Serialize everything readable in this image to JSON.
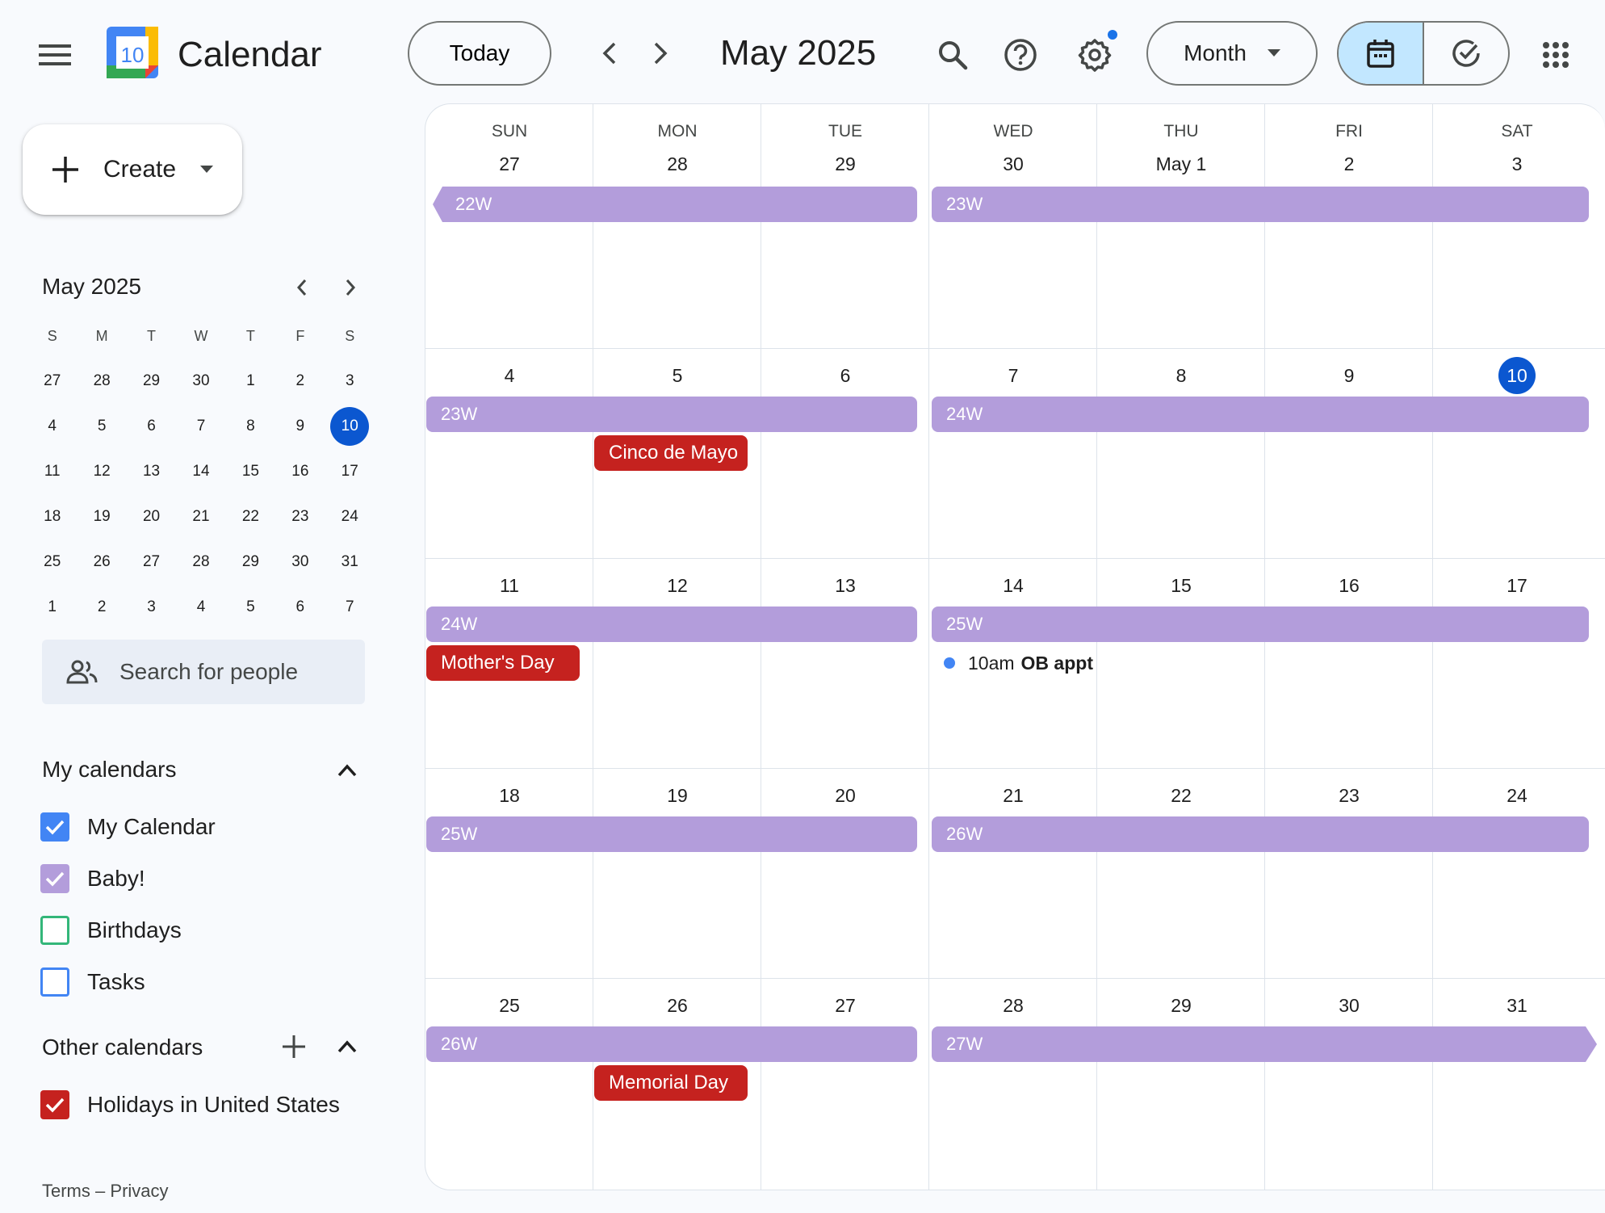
{
  "header": {
    "app_title": "Calendar",
    "logo_day": "10",
    "today_label": "Today",
    "period_title": "May 2025",
    "view_label": "Month"
  },
  "icons": {
    "menu": "hamburger-menu-icon",
    "prev": "chevron-left-icon",
    "next": "chevron-right-icon",
    "search": "search-icon",
    "help": "help-icon",
    "settings": "gear-icon",
    "dropdown": "caret-down-icon",
    "calendar_mode": "calendar-icon",
    "tasks_mode": "task-check-icon",
    "apps": "apps-grid-icon",
    "create": "plus-icon",
    "people": "people-icon"
  },
  "colors": {
    "accent": "#0b57d0",
    "notification_dot": "#1a73e8",
    "week_bar": "#b39ddb",
    "holiday_event": "#c5221f",
    "timed_event_dot": "#4285f4",
    "mode_selected_bg": "#c2e7ff"
  },
  "create": {
    "label": "Create"
  },
  "mini_calendar": {
    "title": "May 2025",
    "weekdays": [
      "S",
      "M",
      "T",
      "W",
      "T",
      "F",
      "S"
    ],
    "weeks": [
      [
        "27",
        "28",
        "29",
        "30",
        "1",
        "2",
        "3"
      ],
      [
        "4",
        "5",
        "6",
        "7",
        "8",
        "9",
        "10"
      ],
      [
        "11",
        "12",
        "13",
        "14",
        "15",
        "16",
        "17"
      ],
      [
        "18",
        "19",
        "20",
        "21",
        "22",
        "23",
        "24"
      ],
      [
        "25",
        "26",
        "27",
        "28",
        "29",
        "30",
        "31"
      ],
      [
        "1",
        "2",
        "3",
        "4",
        "5",
        "6",
        "7"
      ]
    ],
    "selected": "10"
  },
  "people_search": {
    "placeholder": "Search for people"
  },
  "my_calendars": {
    "title": "My calendars",
    "items": [
      {
        "label": "My Calendar",
        "color": "#4285f4",
        "checked": true
      },
      {
        "label": "Baby!",
        "color": "#b39ddb",
        "checked": true
      },
      {
        "label": "Birthdays",
        "color": "#33b679",
        "checked": false
      },
      {
        "label": "Tasks",
        "color": "#4285f4",
        "checked": false
      }
    ]
  },
  "other_calendars": {
    "title": "Other calendars",
    "items": [
      {
        "label": "Holidays in United States",
        "color": "#c5221f",
        "checked": true
      }
    ]
  },
  "footer": {
    "terms": "Terms",
    "sep": "–",
    "privacy": "Privacy"
  },
  "month": {
    "weekdays": [
      "SUN",
      "MON",
      "TUE",
      "WED",
      "THU",
      "FRI",
      "SAT"
    ],
    "weeks": [
      {
        "days": [
          "27",
          "28",
          "29",
          "30",
          "May 1",
          "2",
          "3"
        ],
        "bars": [
          {
            "label": "22W",
            "start": 0,
            "span": 3,
            "cont_left": true
          },
          {
            "label": "23W",
            "start": 3,
            "span": 4
          }
        ],
        "events": []
      },
      {
        "days": [
          "4",
          "5",
          "6",
          "7",
          "8",
          "9",
          "10"
        ],
        "today_index": 6,
        "bars": [
          {
            "label": "23W",
            "start": 0,
            "span": 3
          },
          {
            "label": "24W",
            "start": 3,
            "span": 4
          }
        ],
        "events": [
          {
            "kind": "chip",
            "label": "Cinco de Mayo",
            "day": 1
          }
        ]
      },
      {
        "days": [
          "11",
          "12",
          "13",
          "14",
          "15",
          "16",
          "17"
        ],
        "bars": [
          {
            "label": "24W",
            "start": 0,
            "span": 3
          },
          {
            "label": "25W",
            "start": 3,
            "span": 4
          }
        ],
        "events": [
          {
            "kind": "chip",
            "label": "Mother's Day",
            "day": 0
          },
          {
            "kind": "timed",
            "time": "10am",
            "label": "OB appt",
            "day": 3
          }
        ]
      },
      {
        "days": [
          "18",
          "19",
          "20",
          "21",
          "22",
          "23",
          "24"
        ],
        "bars": [
          {
            "label": "25W",
            "start": 0,
            "span": 3
          },
          {
            "label": "26W",
            "start": 3,
            "span": 4
          }
        ],
        "events": []
      },
      {
        "days": [
          "25",
          "26",
          "27",
          "28",
          "29",
          "30",
          "31"
        ],
        "bars": [
          {
            "label": "26W",
            "start": 0,
            "span": 3
          },
          {
            "label": "27W",
            "start": 3,
            "span": 4,
            "cont_right": true
          }
        ],
        "events": [
          {
            "kind": "chip",
            "label": "Memorial Day",
            "day": 1
          }
        ]
      }
    ]
  }
}
